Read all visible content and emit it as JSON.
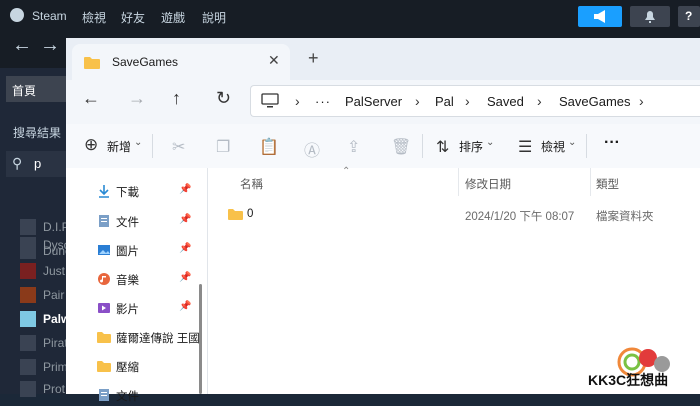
{
  "steam": {
    "brand": "Steam",
    "menu": [
      "檢視",
      "好友",
      "遊戲",
      "說明"
    ],
    "help_label": "?",
    "home_label": "首頁",
    "search_label": "搜尋結果",
    "search_query": "p",
    "games": [
      {
        "name": "D.I.P."
      },
      {
        "name": "Dune"
      },
      {
        "name": "Dyson"
      },
      {
        "name": "Just"
      },
      {
        "name": "Pair"
      },
      {
        "name": "Palworld"
      },
      {
        "name": "Pirat"
      },
      {
        "name": "Prim"
      },
      {
        "name": "Prot"
      }
    ]
  },
  "explorer": {
    "tab_title": "SaveGames",
    "breadcrumb": [
      "PalServer",
      "Pal",
      "Saved",
      "SaveGames"
    ],
    "toolbar": {
      "new_label": "新增",
      "sort_label": "排序",
      "view_label": "檢視",
      "more_label": "···"
    },
    "nav_items": [
      {
        "label": "下載",
        "icon": "download-icon",
        "pinned": true
      },
      {
        "label": "文件",
        "icon": "document-icon",
        "pinned": true
      },
      {
        "label": "圖片",
        "icon": "picture-icon",
        "pinned": true
      },
      {
        "label": "音樂",
        "icon": "music-icon",
        "pinned": true
      },
      {
        "label": "影片",
        "icon": "video-icon",
        "pinned": true
      },
      {
        "label": "薩爾達傳說 王國",
        "icon": "folder-icon",
        "pinned": false
      },
      {
        "label": "壓縮",
        "icon": "folder-icon",
        "pinned": false
      },
      {
        "label": "文件",
        "icon": "document-icon",
        "pinned": false
      }
    ],
    "columns": [
      "名稱",
      "修改日期",
      "類型"
    ],
    "files": [
      {
        "name": "0",
        "modified": "2024/1/20 下午 08:07",
        "type": "檔案資料夾"
      }
    ]
  },
  "watermark": {
    "text": "KK3C狂想曲"
  },
  "colors": {
    "steam_accent": "#1a9fff",
    "folder": "#f8c14a",
    "download": "#2a8ad4"
  }
}
